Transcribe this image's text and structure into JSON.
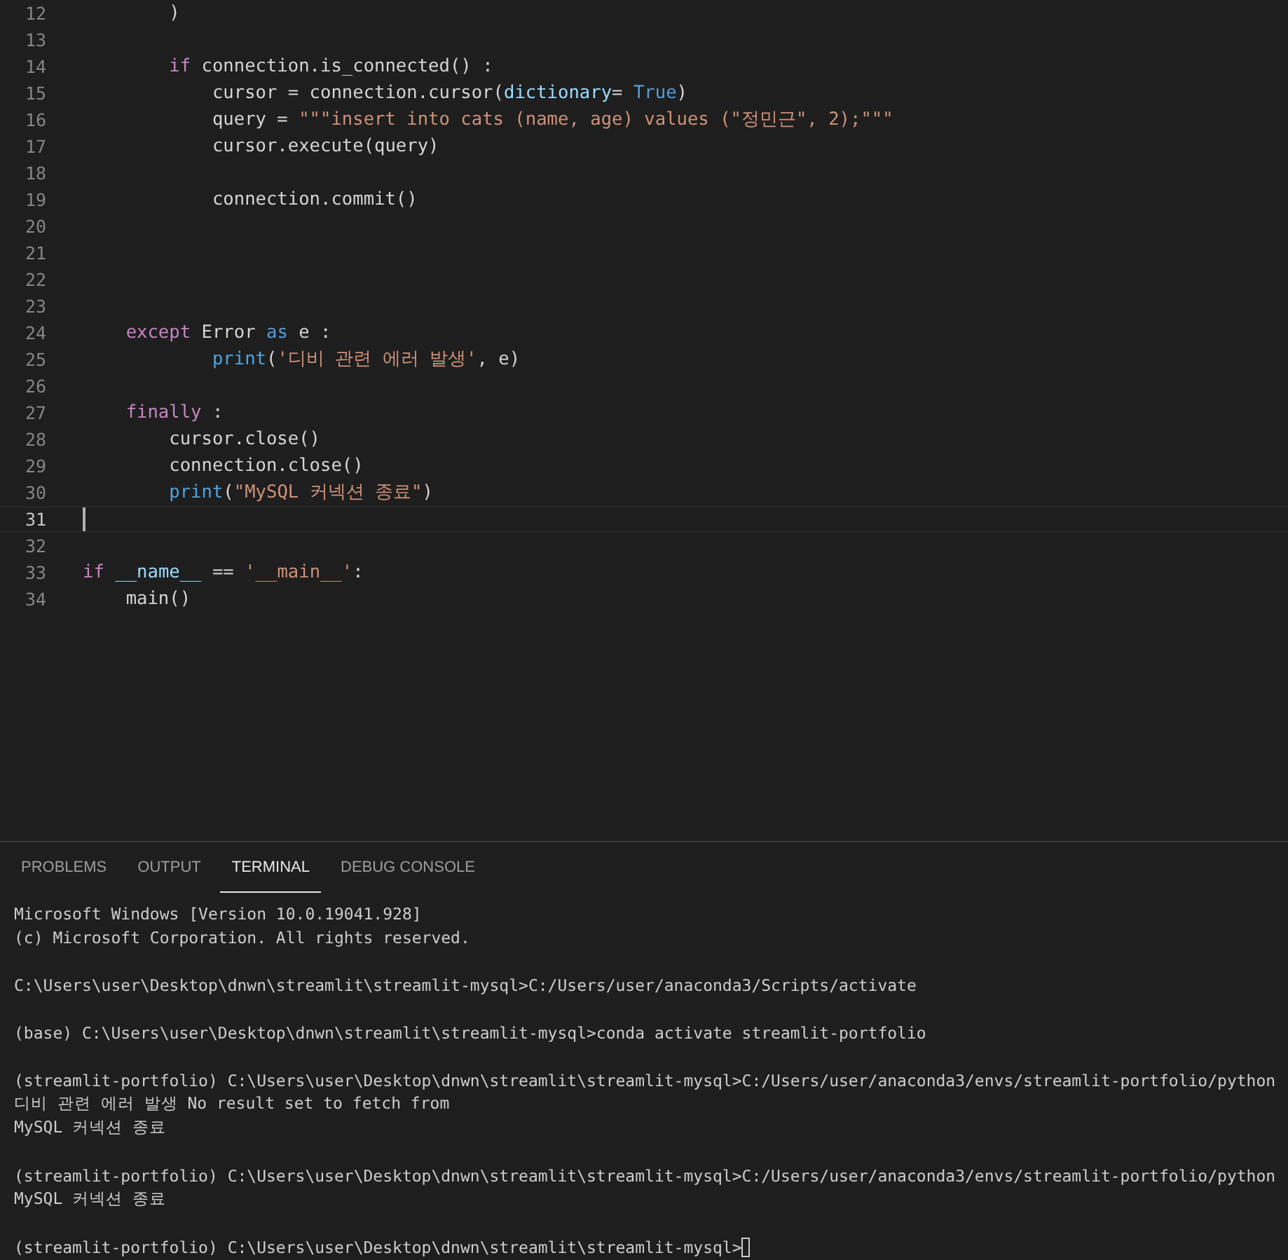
{
  "editor": {
    "lines": [
      {
        "number": "12",
        "current": false,
        "tokens": [
          {
            "kind": "text",
            "text": "        )"
          }
        ]
      },
      {
        "number": "13",
        "current": false
      },
      {
        "number": "14",
        "current": false,
        "tokens": [
          {
            "kind": "keyword",
            "text": "        if"
          },
          {
            "kind": "text",
            "text": " connection.is_connected() :"
          }
        ]
      },
      {
        "number": "15",
        "current": false,
        "tokens": [
          {
            "kind": "text",
            "text": "            cursor = connection.cursor("
          },
          {
            "kind": "param",
            "text": "dictionary"
          },
          {
            "kind": "text",
            "text": "= "
          },
          {
            "kind": "constant",
            "text": "True"
          },
          {
            "kind": "text",
            "text": ")"
          }
        ]
      },
      {
        "number": "16",
        "current": false,
        "tokens": [
          {
            "kind": "text",
            "text": "            query = "
          },
          {
            "kind": "string",
            "text": "\"\"\"insert into cats (name, age) values (\"정민근\", 2);\"\"\""
          }
        ]
      },
      {
        "number": "17",
        "current": false,
        "tokens": [
          {
            "kind": "text",
            "text": "            cursor.execute(query)"
          }
        ]
      },
      {
        "number": "18",
        "current": false
      },
      {
        "number": "19",
        "current": false,
        "tokens": [
          {
            "kind": "text",
            "text": "            connection.commit()"
          }
        ]
      },
      {
        "number": "20",
        "current": false
      },
      {
        "number": "21",
        "current": false
      },
      {
        "number": "22",
        "current": false
      },
      {
        "number": "23",
        "current": false
      },
      {
        "number": "24",
        "current": false,
        "tokens": [
          {
            "kind": "keyword",
            "text": "    except"
          },
          {
            "kind": "text",
            "text": " Error "
          },
          {
            "kind": "constant",
            "text": "as"
          },
          {
            "kind": "text",
            "text": " e :"
          }
        ]
      },
      {
        "number": "25",
        "current": false,
        "tokens": [
          {
            "kind": "builtin",
            "text": "            print"
          },
          {
            "kind": "text",
            "text": "("
          },
          {
            "kind": "string",
            "text": "'디비 관련 에러 발생'"
          },
          {
            "kind": "text",
            "text": ", e)"
          }
        ]
      },
      {
        "number": "26",
        "current": false
      },
      {
        "number": "27",
        "current": false,
        "tokens": [
          {
            "kind": "keyword",
            "text": "    finally"
          },
          {
            "kind": "text",
            "text": " :"
          }
        ]
      },
      {
        "number": "28",
        "current": false,
        "tokens": [
          {
            "kind": "text",
            "text": "        cursor.close()"
          }
        ]
      },
      {
        "number": "29",
        "current": false,
        "tokens": [
          {
            "kind": "text",
            "text": "        connection.close()"
          }
        ]
      },
      {
        "number": "30",
        "current": false,
        "tokens": [
          {
            "kind": "builtin",
            "text": "        print"
          },
          {
            "kind": "text",
            "text": "("
          },
          {
            "kind": "string",
            "text": "\"MySQL 커넥션 종료\""
          },
          {
            "kind": "text",
            "text": ")"
          }
        ]
      },
      {
        "number": "31",
        "current": true
      },
      {
        "number": "32",
        "current": false
      },
      {
        "number": "33",
        "current": false,
        "tokens": [
          {
            "kind": "keyword",
            "text": "if"
          },
          {
            "kind": "param",
            "text": " __name__"
          },
          {
            "kind": "text",
            "text": " == "
          },
          {
            "kind": "string",
            "text": "'__main__'"
          },
          {
            "kind": "text",
            "text": ":"
          }
        ]
      },
      {
        "number": "34",
        "current": false,
        "tokens": [
          {
            "kind": "text",
            "text": "    main()"
          }
        ]
      }
    ]
  },
  "panel": {
    "tabs": [
      {
        "label": "PROBLEMS",
        "selected": false
      },
      {
        "label": "OUTPUT",
        "selected": false
      },
      {
        "label": "TERMINAL",
        "selected": true
      },
      {
        "label": "DEBUG CONSOLE",
        "selected": false
      }
    ],
    "terminal": {
      "blocks": [
        [
          "Microsoft Windows [Version 10.0.19041.928]",
          "(c) Microsoft Corporation. All rights reserved."
        ],
        [
          "C:\\Users\\user\\Desktop\\dnwn\\streamlit\\streamlit-mysql>C:/Users/user/anaconda3/Scripts/activate"
        ],
        [
          "(base) C:\\Users\\user\\Desktop\\dnwn\\streamlit\\streamlit-mysql>conda activate streamlit-portfolio"
        ],
        [
          "(streamlit-portfolio) C:\\Users\\user\\Desktop\\dnwn\\streamlit\\streamlit-mysql>C:/Users/user/anaconda3/envs/streamlit-portfolio/python",
          "디비 관련 에러 발생 No result set to fetch from",
          "MySQL 커넥션 종료"
        ],
        [
          "(streamlit-portfolio) C:\\Users\\user\\Desktop\\dnwn\\streamlit\\streamlit-mysql>C:/Users/user/anaconda3/envs/streamlit-portfolio/python",
          "MySQL 커넥션 종료"
        ],
        [
          "(streamlit-portfolio) C:\\Users\\user\\Desktop\\dnwn\\streamlit\\streamlit-mysql>"
        ]
      ]
    }
  }
}
